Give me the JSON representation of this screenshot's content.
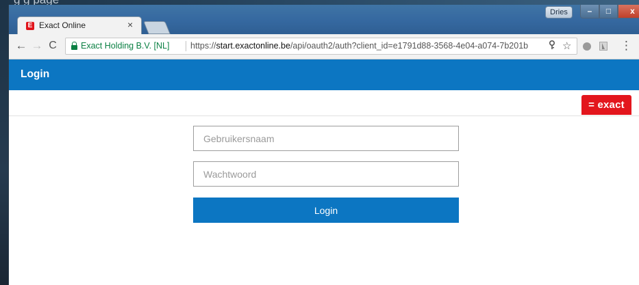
{
  "background": {
    "behind_text": "g                    g page"
  },
  "browser": {
    "tab": {
      "title": "Exact Online",
      "favicon_letter": "E",
      "close_label": "×"
    },
    "profile_name": "Dries",
    "window_controls": {
      "minimize": "–",
      "maximize": "□",
      "close": "x"
    },
    "nav": {
      "back": "←",
      "forward": "→",
      "reload": "C"
    },
    "omnibox": {
      "site_identity": "Exact Holding B.V. [NL]",
      "url_scheme": "https://",
      "url_host": "start.exactonline.be",
      "url_path": "/api/oauth2/auth?client_id=e1791d88-3568-4e04-a074-7b201b"
    },
    "icons": {
      "lock": "lock-icon",
      "key": "key-icon",
      "star": "☆",
      "menu": "⋮"
    }
  },
  "page": {
    "header_title": "Login",
    "brand_logo": "= exact",
    "form": {
      "username_placeholder": "Gebruikersnaam",
      "username_value": "",
      "password_placeholder": "Wachtwoord",
      "password_value": "",
      "submit_label": "Login"
    }
  },
  "colors": {
    "header_blue": "#0c76c2",
    "brand_red": "#e3161d",
    "secure_green": "#0b8043"
  }
}
